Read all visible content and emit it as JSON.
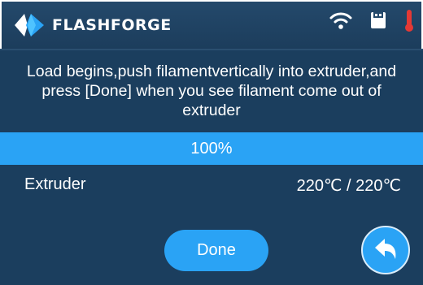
{
  "header": {
    "brand": "FLASHFORGE",
    "icons": [
      "logo-icon",
      "wifi-icon",
      "usb-drive-icon",
      "thermometer-icon"
    ],
    "accent_warning": "#e53935"
  },
  "message": "Load begins,push filamentvertically into extruder,and press [Done] when you see filament come out of extruder",
  "progress": {
    "label": "100%",
    "value": 1.0
  },
  "extruder": {
    "label": "Extruder",
    "temperature": "220℃ / 220℃"
  },
  "buttons": {
    "done": "Done",
    "back_icon": "back-arrow-icon"
  },
  "colors": {
    "background": "#1b3e5e",
    "accent": "#2aa3f5",
    "text": "#ffffff"
  }
}
